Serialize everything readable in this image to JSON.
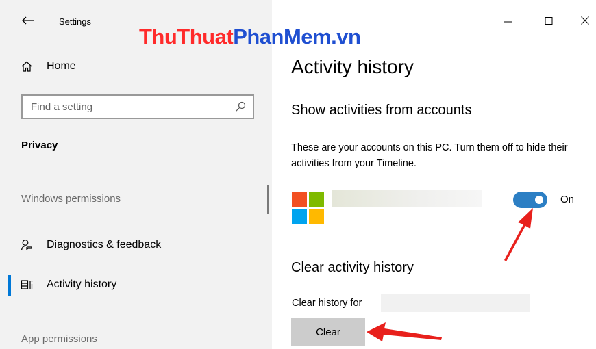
{
  "window": {
    "app_title": "Settings",
    "controls": [
      "minimize",
      "maximize",
      "close"
    ]
  },
  "watermark": {
    "part1": "ThuThuat",
    "part2": "PhanMem.vn"
  },
  "sidebar": {
    "home_label": "Home",
    "search": {
      "placeholder": "Find a setting",
      "value": ""
    },
    "section_title": "Privacy",
    "groups": [
      {
        "heading": "Windows permissions",
        "items": [
          {
            "label": "Diagnostics & feedback",
            "icon": "diagnostics-icon",
            "selected": false
          },
          {
            "label": "Activity history",
            "icon": "activity-history-icon",
            "selected": true
          }
        ]
      },
      {
        "heading": "App permissions",
        "items": []
      }
    ]
  },
  "main": {
    "title": "Activity history",
    "accounts_heading": "Show activities from accounts",
    "accounts_description": "These are your accounts on this PC. Turn them off to hide their activities from your Timeline.",
    "account_toggle": {
      "state_label": "On",
      "on": true
    },
    "clear_heading": "Clear activity history",
    "clear_for_label": "Clear history for",
    "clear_button_label": "Clear"
  },
  "colors": {
    "accent": "#0078d7",
    "toggle_on": "#2c7fc4",
    "arrow": "#e8201c",
    "ms_logo": [
      "#f25022",
      "#7fba00",
      "#00a4ef",
      "#ffb900"
    ]
  }
}
